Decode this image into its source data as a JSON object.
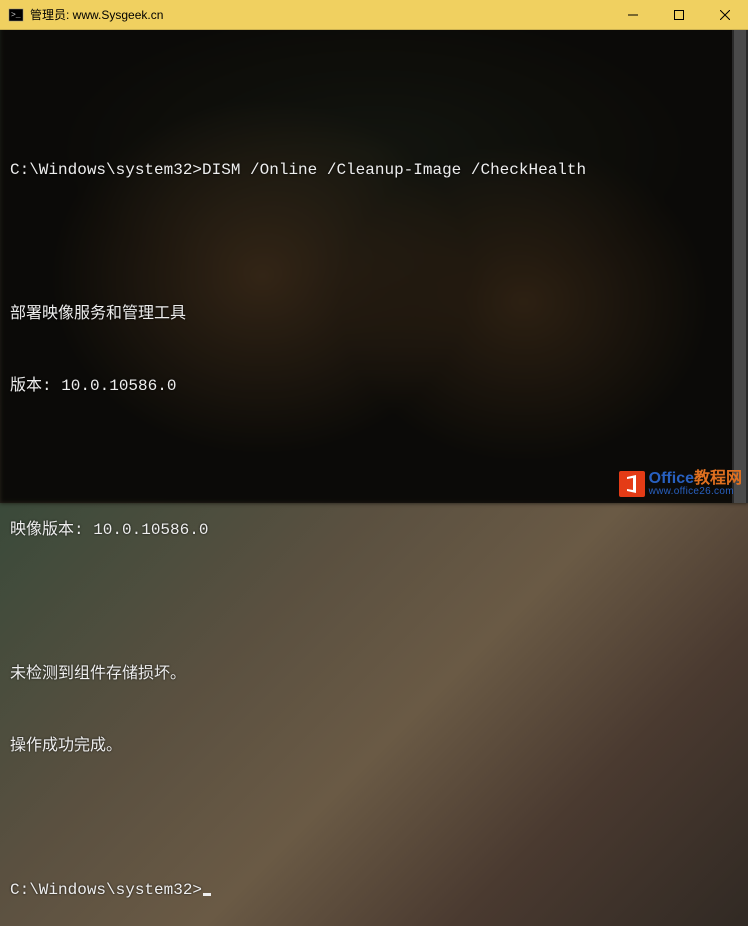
{
  "titlebar": {
    "title": "管理员:  www.Sysgeek.cn"
  },
  "terminal": {
    "lines": [
      "",
      "C:\\Windows\\system32>DISM /Online /Cleanup-Image /CheckHealth",
      "",
      "部署映像服务和管理工具",
      "版本: 10.0.10586.0",
      "",
      "映像版本: 10.0.10586.0",
      "",
      "未检测到组件存储损坏。",
      "操作成功完成。",
      "",
      "C:\\Windows\\system32>"
    ]
  },
  "watermark": {
    "brand_main": "Office",
    "brand_suffix": "教程网",
    "url": "www.office26.com"
  }
}
